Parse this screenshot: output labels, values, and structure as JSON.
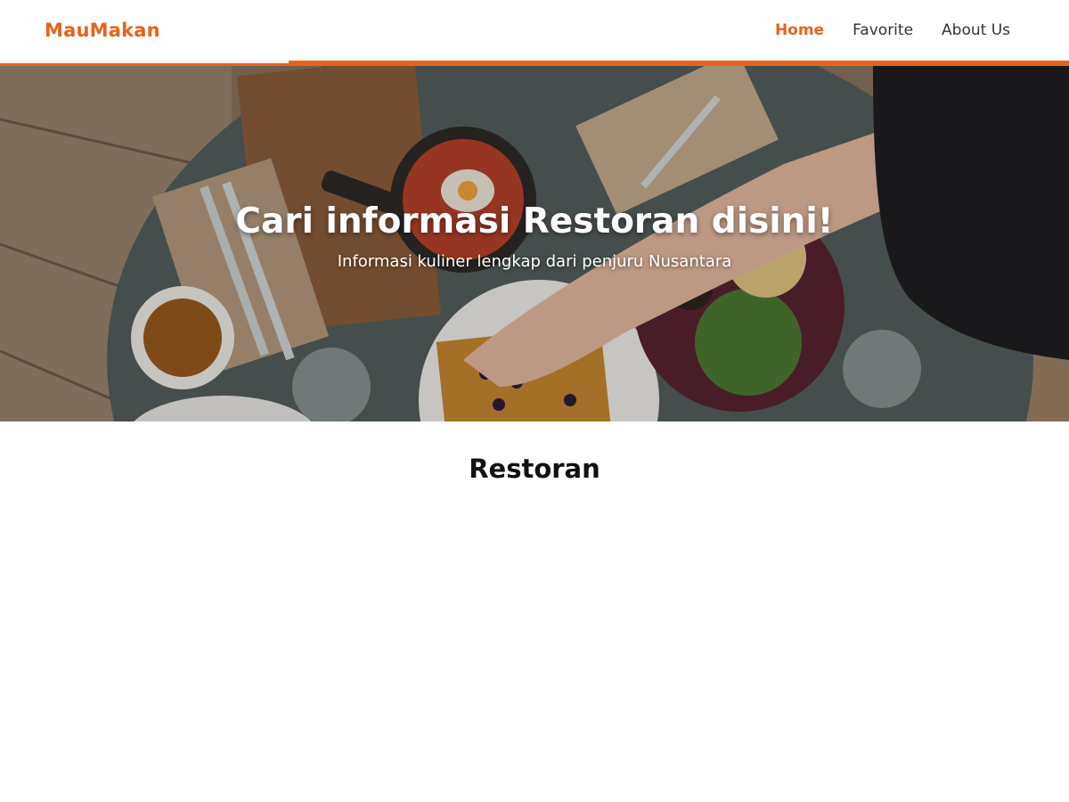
{
  "brand": {
    "name": "MauMakan"
  },
  "nav": {
    "items": [
      {
        "label": "Home",
        "active": true
      },
      {
        "label": "Favorite",
        "active": false
      },
      {
        "label": "About Us",
        "active": false
      }
    ]
  },
  "hero": {
    "title": "Cari informasi Restoran disini!",
    "subtitle": "Informasi kuliner lengkap dari penjuru Nusantara",
    "image": "restaurant-table-food-photo"
  },
  "main": {
    "section_title": "Restoran"
  },
  "colors": {
    "accent": "#e8631a",
    "text": "#333333",
    "background": "#ffffff"
  }
}
